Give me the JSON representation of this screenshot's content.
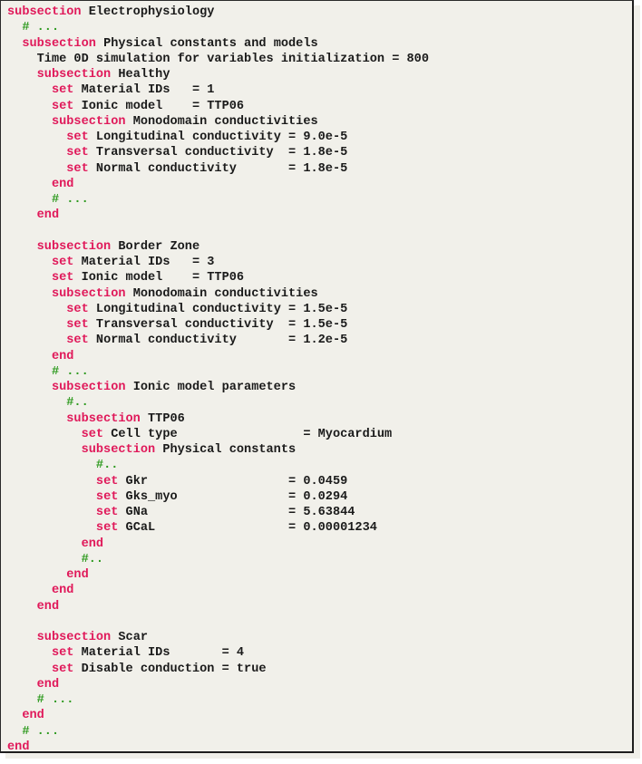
{
  "document": {
    "type": "parameter-file-listing",
    "colors": {
      "keyword": "#e0195a",
      "comment": "#2e9a1f",
      "text": "#1a1a1a",
      "background": "#f1f0ea"
    },
    "lines": [
      {
        "indent": "",
        "kw": "subsection",
        "text": " Electrophysiology",
        "comment": ""
      },
      {
        "indent": "  ",
        "kw": "",
        "text": "",
        "comment": "# ..."
      },
      {
        "indent": "  ",
        "kw": "subsection",
        "text": " Physical constants and models",
        "comment": ""
      },
      {
        "indent": "    ",
        "kw": "",
        "text": "Time 0D simulation for variables initialization = 800",
        "comment": ""
      },
      {
        "indent": "    ",
        "kw": "subsection",
        "text": " Healthy",
        "comment": ""
      },
      {
        "indent": "      ",
        "kw": "set",
        "text": " Material IDs   = 1",
        "comment": ""
      },
      {
        "indent": "      ",
        "kw": "set",
        "text": " Ionic model    = TTP06",
        "comment": ""
      },
      {
        "indent": "      ",
        "kw": "subsection",
        "text": " Monodomain conductivities",
        "comment": ""
      },
      {
        "indent": "        ",
        "kw": "set",
        "text": " Longitudinal conductivity = 9.0e-5",
        "comment": ""
      },
      {
        "indent": "        ",
        "kw": "set",
        "text": " Transversal conductivity  = 1.8e-5",
        "comment": ""
      },
      {
        "indent": "        ",
        "kw": "set",
        "text": " Normal conductivity       = 1.8e-5",
        "comment": ""
      },
      {
        "indent": "      ",
        "kw": "end",
        "text": "",
        "comment": ""
      },
      {
        "indent": "      ",
        "kw": "",
        "text": "",
        "comment": "# ..."
      },
      {
        "indent": "    ",
        "kw": "end",
        "text": "",
        "comment": ""
      },
      {
        "indent": "",
        "kw": "",
        "text": "",
        "comment": ""
      },
      {
        "indent": "    ",
        "kw": "subsection",
        "text": " Border Zone",
        "comment": ""
      },
      {
        "indent": "      ",
        "kw": "set",
        "text": " Material IDs   = 3",
        "comment": ""
      },
      {
        "indent": "      ",
        "kw": "set",
        "text": " Ionic model    = TTP06",
        "comment": ""
      },
      {
        "indent": "      ",
        "kw": "subsection",
        "text": " Monodomain conductivities",
        "comment": ""
      },
      {
        "indent": "        ",
        "kw": "set",
        "text": " Longitudinal conductivity = 1.5e-5",
        "comment": ""
      },
      {
        "indent": "        ",
        "kw": "set",
        "text": " Transversal conductivity  = 1.5e-5",
        "comment": ""
      },
      {
        "indent": "        ",
        "kw": "set",
        "text": " Normal conductivity       = 1.2e-5",
        "comment": ""
      },
      {
        "indent": "      ",
        "kw": "end",
        "text": "",
        "comment": ""
      },
      {
        "indent": "      ",
        "kw": "",
        "text": "",
        "comment": "# ..."
      },
      {
        "indent": "      ",
        "kw": "subsection",
        "text": " Ionic model parameters",
        "comment": ""
      },
      {
        "indent": "        ",
        "kw": "",
        "text": "",
        "comment": "#.."
      },
      {
        "indent": "        ",
        "kw": "subsection",
        "text": " TTP06",
        "comment": ""
      },
      {
        "indent": "          ",
        "kw": "set",
        "text": " Cell type                 = Myocardium",
        "comment": ""
      },
      {
        "indent": "          ",
        "kw": "subsection",
        "text": " Physical constants",
        "comment": ""
      },
      {
        "indent": "            ",
        "kw": "",
        "text": "",
        "comment": "#.."
      },
      {
        "indent": "            ",
        "kw": "set",
        "text": " Gkr                   = 0.0459",
        "comment": ""
      },
      {
        "indent": "            ",
        "kw": "set",
        "text": " Gks_myo               = 0.0294",
        "comment": ""
      },
      {
        "indent": "            ",
        "kw": "set",
        "text": " GNa                   = 5.63844",
        "comment": ""
      },
      {
        "indent": "            ",
        "kw": "set",
        "text": " GCaL                  = 0.00001234",
        "comment": ""
      },
      {
        "indent": "          ",
        "kw": "end",
        "text": "",
        "comment": ""
      },
      {
        "indent": "          ",
        "kw": "",
        "text": "",
        "comment": "#.."
      },
      {
        "indent": "        ",
        "kw": "end",
        "text": "",
        "comment": ""
      },
      {
        "indent": "      ",
        "kw": "end",
        "text": "",
        "comment": ""
      },
      {
        "indent": "    ",
        "kw": "end",
        "text": "",
        "comment": ""
      },
      {
        "indent": "",
        "kw": "",
        "text": "",
        "comment": ""
      },
      {
        "indent": "    ",
        "kw": "subsection",
        "text": " Scar",
        "comment": ""
      },
      {
        "indent": "      ",
        "kw": "set",
        "text": " Material IDs       = 4",
        "comment": ""
      },
      {
        "indent": "      ",
        "kw": "set",
        "text": " Disable conduction = true",
        "comment": ""
      },
      {
        "indent": "    ",
        "kw": "end",
        "text": "",
        "comment": ""
      },
      {
        "indent": "    ",
        "kw": "",
        "text": "",
        "comment": "# ..."
      },
      {
        "indent": "  ",
        "kw": "end",
        "text": "",
        "comment": ""
      },
      {
        "indent": "  ",
        "kw": "",
        "text": "",
        "comment": "# ..."
      },
      {
        "indent": "",
        "kw": "end",
        "text": "",
        "comment": ""
      }
    ]
  }
}
